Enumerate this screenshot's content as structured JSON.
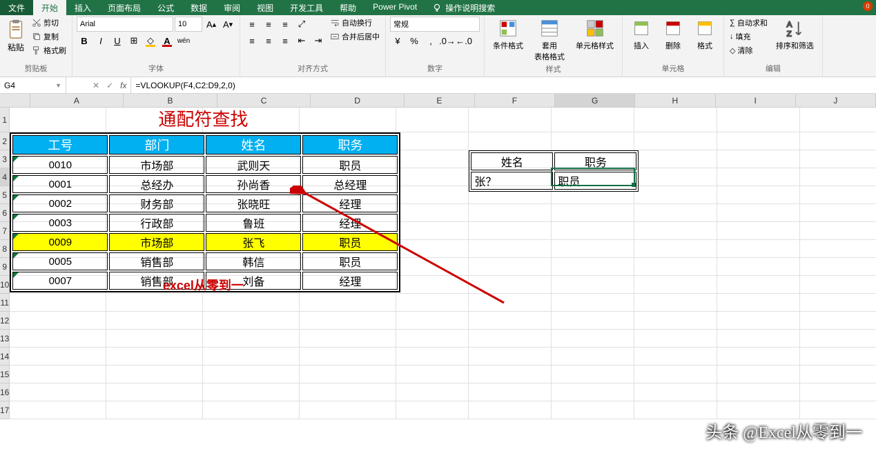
{
  "menu": {
    "file": "文件",
    "tabs": [
      "开始",
      "插入",
      "页面布局",
      "公式",
      "数据",
      "审阅",
      "视图",
      "开发工具",
      "帮助",
      "Power Pivot"
    ],
    "active": "开始",
    "search": "操作说明搜索"
  },
  "ribbon": {
    "clipboard": {
      "paste": "粘贴",
      "cut": "剪切",
      "copy": "复制",
      "painter": "格式刷",
      "label": "剪贴板"
    },
    "font": {
      "name": "Arial",
      "size": "10",
      "label": "字体"
    },
    "align": {
      "wrap": "自动换行",
      "merge": "合并后居中",
      "label": "对齐方式"
    },
    "number": {
      "format": "常规",
      "label": "数字"
    },
    "styles": {
      "cond": "条件格式",
      "table": "套用\n表格格式",
      "cell": "单元格样式",
      "label": "样式"
    },
    "cells": {
      "insert": "插入",
      "delete": "删除",
      "format": "格式",
      "label": "单元格"
    },
    "editing": {
      "sum": "自动求和",
      "fill": "填充",
      "clear": "清除",
      "sort": "排序和筛选",
      "label": "编辑"
    }
  },
  "nameBox": "G4",
  "formula": "=VLOOKUP(F4,C2:D9,2,0)",
  "columns": [
    "A",
    "B",
    "C",
    "D",
    "E",
    "F",
    "G",
    "H",
    "I",
    "J"
  ],
  "title": "通配符查找",
  "headers": [
    "工号",
    "部门",
    "姓名",
    "职务"
  ],
  "rows": [
    {
      "id": "0010",
      "dept": "市场部",
      "name": "武则天",
      "role": "职员"
    },
    {
      "id": "0001",
      "dept": "总经办",
      "name": "孙尚香",
      "role": "总经理"
    },
    {
      "id": "0002",
      "dept": "财务部",
      "name": "张晓旺",
      "role": "经理"
    },
    {
      "id": "0003",
      "dept": "行政部",
      "name": "鲁班",
      "role": "经理"
    },
    {
      "id": "0009",
      "dept": "市场部",
      "name": "张飞",
      "role": "职员",
      "hl": true
    },
    {
      "id": "0005",
      "dept": "销售部",
      "name": "韩信",
      "role": "职员"
    },
    {
      "id": "0007",
      "dept": "销售部",
      "name": "刘备",
      "role": "经理"
    }
  ],
  "footer": "excel从零到一",
  "lookup": {
    "h1": "姓名",
    "h2": "职务",
    "v1": "张？",
    "v2": "职员"
  },
  "watermark": "头条 @Excel从零到一",
  "notif": "0"
}
